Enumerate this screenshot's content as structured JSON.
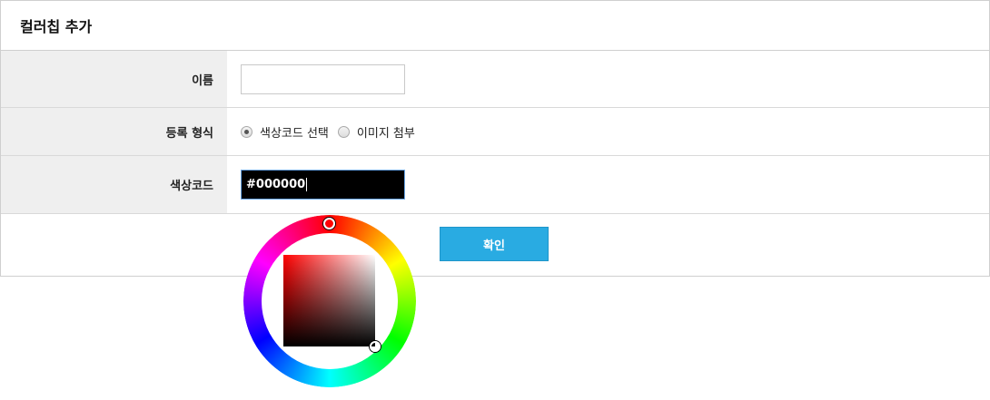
{
  "header": {
    "title": "컬러칩 추가"
  },
  "form": {
    "name": {
      "label": "이름",
      "value": ""
    },
    "registration_type": {
      "label": "등록 형식",
      "options": [
        {
          "label": "색상코드 선택",
          "checked": true
        },
        {
          "label": "이미지 첨부",
          "checked": false
        }
      ]
    },
    "color_code": {
      "label": "색상코드",
      "value": "#000000"
    }
  },
  "confirm_label": "확인",
  "colors": {
    "accent_button": "#29abe2",
    "label_background": "#efefef",
    "color_field_background": "#000000"
  },
  "icons": {
    "hue_marker": "circle-handle",
    "sv_marker": "circle-handle"
  }
}
